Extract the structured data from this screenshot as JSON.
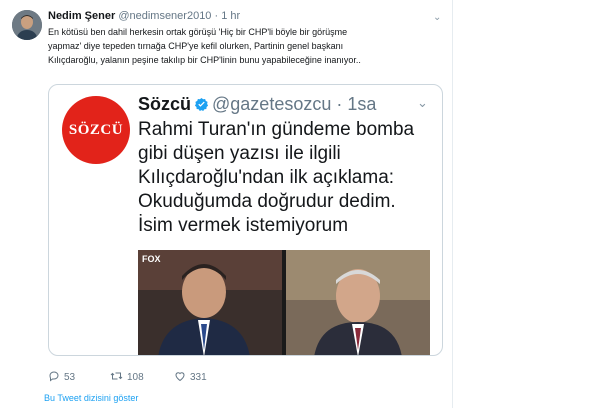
{
  "tweet": {
    "author_name": "Nedim Şener",
    "author_handle": "@nedimsener2010",
    "separator": "·",
    "time": "1 hr",
    "text_lines": [
      "En kötüsü ben dahil herkesin ortak görüşü 'Hiç bir CHP'li böyle bir görüşme",
      "yapmaz' diye tepeden tırnağa CHP'ye kefil olurken, Partinin genel başkanı",
      "Kılıçdaroğlu, yalanın peşine takılıp bir CHP'linin bunu yapabileceğine inanıyor.."
    ],
    "icons": {
      "avatar": "avatar-photo",
      "menu": "chevron-down-icon"
    }
  },
  "quote": {
    "logo_text": "SÖZCÜ",
    "name": "Sözcü",
    "handle": "@gazetesozcu",
    "separator": "·",
    "time": "1sa",
    "text_lines": [
      "Rahmi Turan'ın gündeme bomba",
      "gibi düşen yazısı ile ilgili",
      "Kılıçdaroğlu'ndan ilk açıklama:",
      "Okuduğumda doğrudur dedim.",
      "İsim vermek istemiyorum"
    ],
    "media_label": "FOX",
    "colors": {
      "logo_bg": "#e2231a",
      "verified": "#1da1f2"
    }
  },
  "actions": {
    "replies": "53",
    "retweets": "108",
    "likes": "331"
  },
  "show_thread_label": "Bu Tweet dizisini göster",
  "colors": {
    "link": "#1da1f2",
    "muted": "#657786",
    "border": "#ccd6dd"
  }
}
